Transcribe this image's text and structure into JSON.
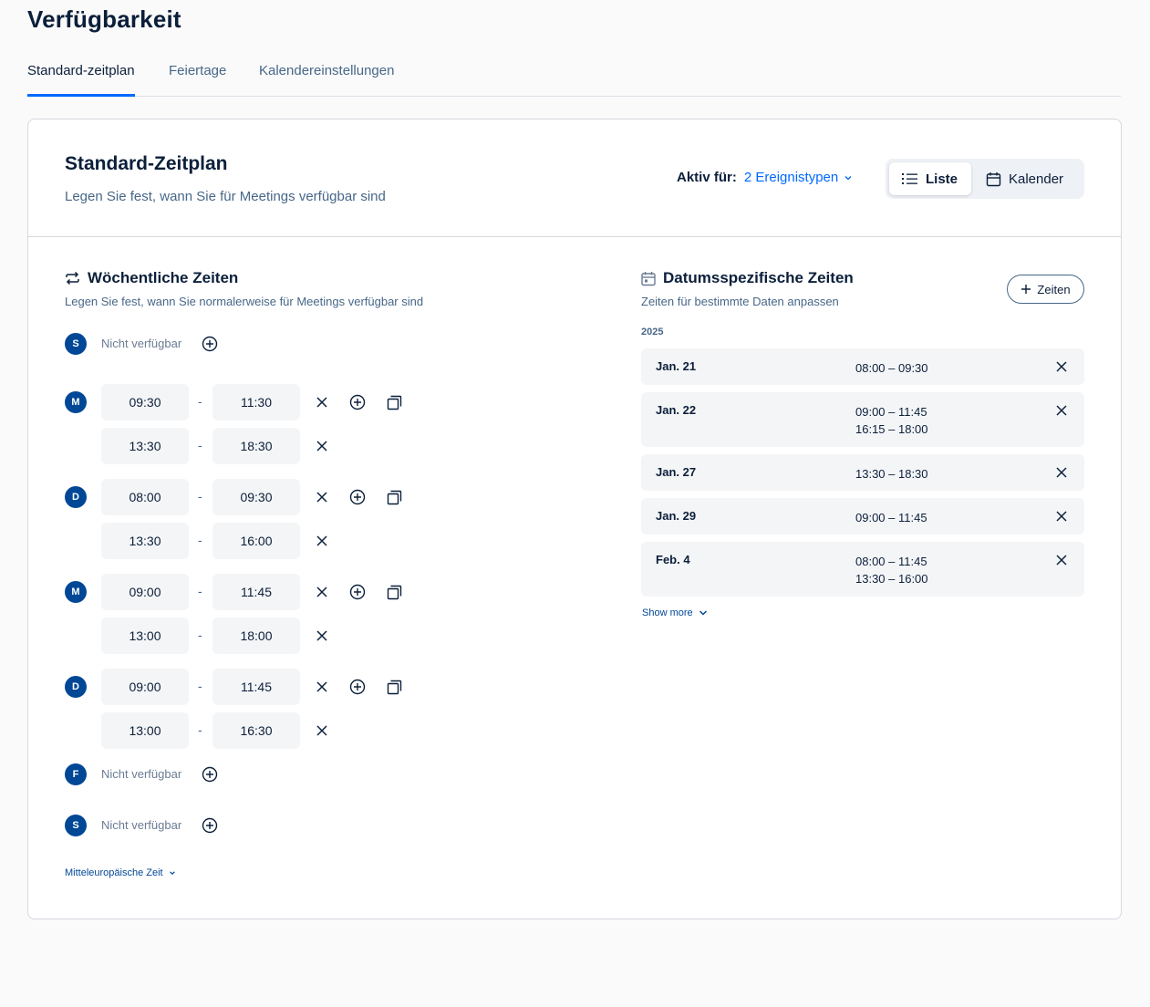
{
  "page": {
    "title": "Verfügbarkeit"
  },
  "tabs": [
    {
      "label": "Standard-zeitplan",
      "active": true
    },
    {
      "label": "Feiertage",
      "active": false
    },
    {
      "label": "Kalendereinstellungen",
      "active": false
    }
  ],
  "schedule": {
    "title": "Standard-Zeitplan",
    "subtitle": "Legen Sie fest, wann Sie für Meetings verfügbar sind",
    "active_for_label": "Aktiv für:",
    "active_for_value": "2 Ereignistypen",
    "view_list": "Liste",
    "view_calendar": "Kalender"
  },
  "weekly": {
    "title": "Wöchentliche Zeiten",
    "subtitle": "Legen Sie fest, wann Sie normalerweise für Meetings verfügbar sind",
    "not_available": "Nicht verfügbar",
    "days": [
      {
        "letter": "S",
        "slots": []
      },
      {
        "letter": "M",
        "slots": [
          [
            "09:30",
            "11:30"
          ],
          [
            "13:30",
            "18:30"
          ]
        ]
      },
      {
        "letter": "D",
        "slots": [
          [
            "08:00",
            "09:30"
          ],
          [
            "13:30",
            "16:00"
          ]
        ]
      },
      {
        "letter": "M",
        "slots": [
          [
            "09:00",
            "11:45"
          ],
          [
            "13:00",
            "18:00"
          ]
        ]
      },
      {
        "letter": "D",
        "slots": [
          [
            "09:00",
            "11:45"
          ],
          [
            "13:00",
            "16:30"
          ]
        ]
      },
      {
        "letter": "F",
        "slots": []
      },
      {
        "letter": "S",
        "slots": []
      }
    ],
    "timezone": "Mitteleuropäische Zeit"
  },
  "date_specific": {
    "title": "Datumsspezifische Zeiten",
    "subtitle": "Zeiten für bestimmte Daten anpassen",
    "add_button": "Zeiten",
    "year": "2025",
    "overrides": [
      {
        "date": "Jan. 21",
        "times": [
          "08:00 – 09:30"
        ]
      },
      {
        "date": "Jan. 22",
        "times": [
          "09:00 – 11:45",
          "16:15 – 18:00"
        ]
      },
      {
        "date": "Jan. 27",
        "times": [
          "13:30 – 18:30"
        ]
      },
      {
        "date": "Jan. 29",
        "times": [
          "09:00 – 11:45"
        ]
      },
      {
        "date": "Feb. 4",
        "times": [
          "08:00 – 11:45",
          "13:30 – 16:00"
        ]
      }
    ],
    "show_more": "Show more"
  },
  "colors": {
    "accent": "#0069ff",
    "badge": "#004796",
    "text": "#0b1f3a",
    "muted": "#476788"
  },
  "icons": [
    "chevron-down-icon",
    "list-icon",
    "calendar-icon",
    "repeat-icon",
    "calendar-day-icon",
    "plus-circle-icon",
    "close-icon",
    "copy-icon",
    "plus-icon"
  ]
}
